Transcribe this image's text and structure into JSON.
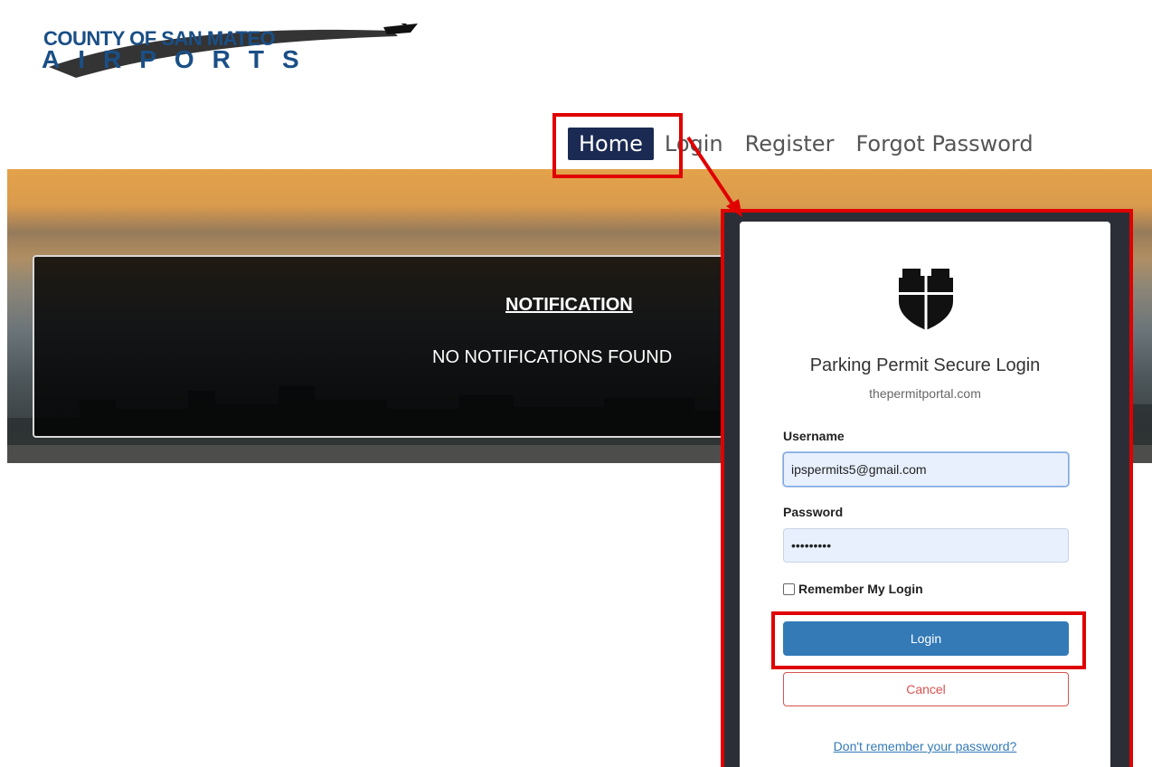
{
  "logo": {
    "line1": "COUNTY OF SAN MATEO",
    "line2": "AIRPORTS"
  },
  "nav": {
    "items": [
      {
        "label": "Home"
      },
      {
        "label": "Login"
      },
      {
        "label": "Register"
      },
      {
        "label": "Forgot Password"
      }
    ]
  },
  "notification": {
    "title": "NOTIFICATION",
    "message": "NO NOTIFICATIONS FOUND"
  },
  "login": {
    "title": "Parking Permit Secure Login",
    "subtitle": "thepermitportal.com",
    "username_label": "Username",
    "username_value": "ipspermits5@gmail.com",
    "password_label": "Password",
    "password_value": "•••••••••",
    "remember_label": "Remember My Login",
    "login_button": "Login",
    "cancel_button": "Cancel",
    "forgot_link": "Don't remember your password?"
  },
  "colors": {
    "nav_active_bg": "#1b2a52",
    "primary": "#337ab7",
    "cancel": "#d9534f",
    "highlight": "#e00000"
  },
  "icons": {
    "shield": "shield-icon"
  }
}
